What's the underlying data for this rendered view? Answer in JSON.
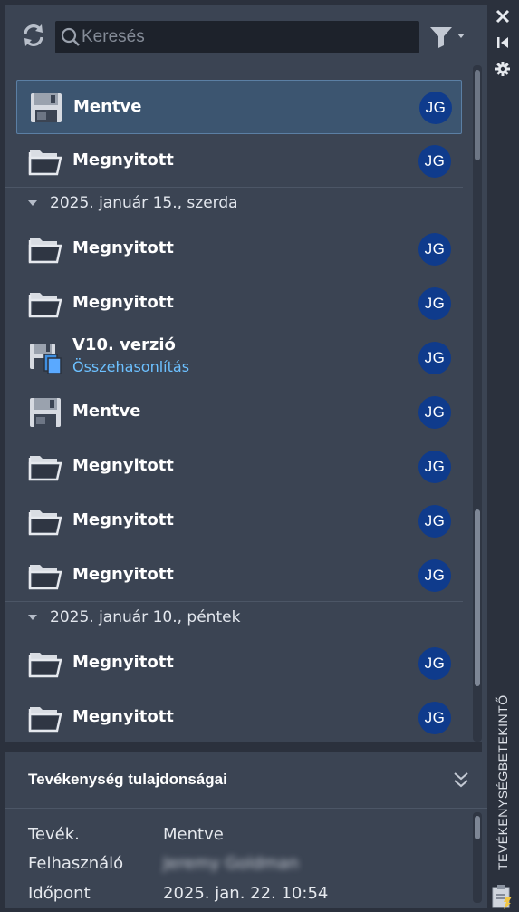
{
  "toolbar": {
    "search_placeholder": "Keresés",
    "refresh_icon": "refresh-icon",
    "filter_icon": "filter-icon"
  },
  "activity_list": [
    {
      "type": "saved",
      "title": "Mentve",
      "subtitle": "",
      "avatar": "JG",
      "selected": true
    },
    {
      "type": "opened",
      "title": "Megnyitott",
      "subtitle": "",
      "avatar": "JG",
      "selected": false
    },
    {
      "type": "day",
      "label": "2025. január 15., szerda"
    },
    {
      "type": "opened",
      "title": "Megnyitott",
      "subtitle": "",
      "avatar": "JG",
      "selected": false
    },
    {
      "type": "opened",
      "title": "Megnyitott",
      "subtitle": "",
      "avatar": "JG",
      "selected": false
    },
    {
      "type": "version",
      "title": "V10. verzió",
      "subtitle": "Összehasonlítás",
      "avatar": "JG",
      "selected": false
    },
    {
      "type": "saved",
      "title": "Mentve",
      "subtitle": "",
      "avatar": "JG",
      "selected": false
    },
    {
      "type": "opened",
      "title": "Megnyitott",
      "subtitle": "",
      "avatar": "JG",
      "selected": false
    },
    {
      "type": "opened",
      "title": "Megnyitott",
      "subtitle": "",
      "avatar": "JG",
      "selected": false
    },
    {
      "type": "opened",
      "title": "Megnyitott",
      "subtitle": "",
      "avatar": "JG",
      "selected": false
    },
    {
      "type": "day",
      "label": "2025. január 10., péntek"
    },
    {
      "type": "opened",
      "title": "Megnyitott",
      "subtitle": "",
      "avatar": "JG",
      "selected": false
    },
    {
      "type": "opened",
      "title": "Megnyitott",
      "subtitle": "",
      "avatar": "JG",
      "selected": false
    }
  ],
  "properties": {
    "title": "Tevékenység tulajdonságai",
    "rows": [
      {
        "key": "Tevék.",
        "value": "Mentve",
        "blurred": false
      },
      {
        "key": "Felhasználó",
        "value": "Jeremy Goldman",
        "blurred": true
      },
      {
        "key": "Időpont",
        "value": "2025. jan. 22. 10:54",
        "blurred": false
      }
    ]
  },
  "side_panel": {
    "label": "TEVÉKENYSÉGBETEKINTŐ",
    "close_icon": "close-icon",
    "collapse_icon": "collapse-icon",
    "settings_icon": "gear-icon"
  },
  "colors": {
    "accent_blue": "#0f3b8c",
    "link_blue": "#6cc0ff",
    "selected_bg": "#3c5570"
  }
}
